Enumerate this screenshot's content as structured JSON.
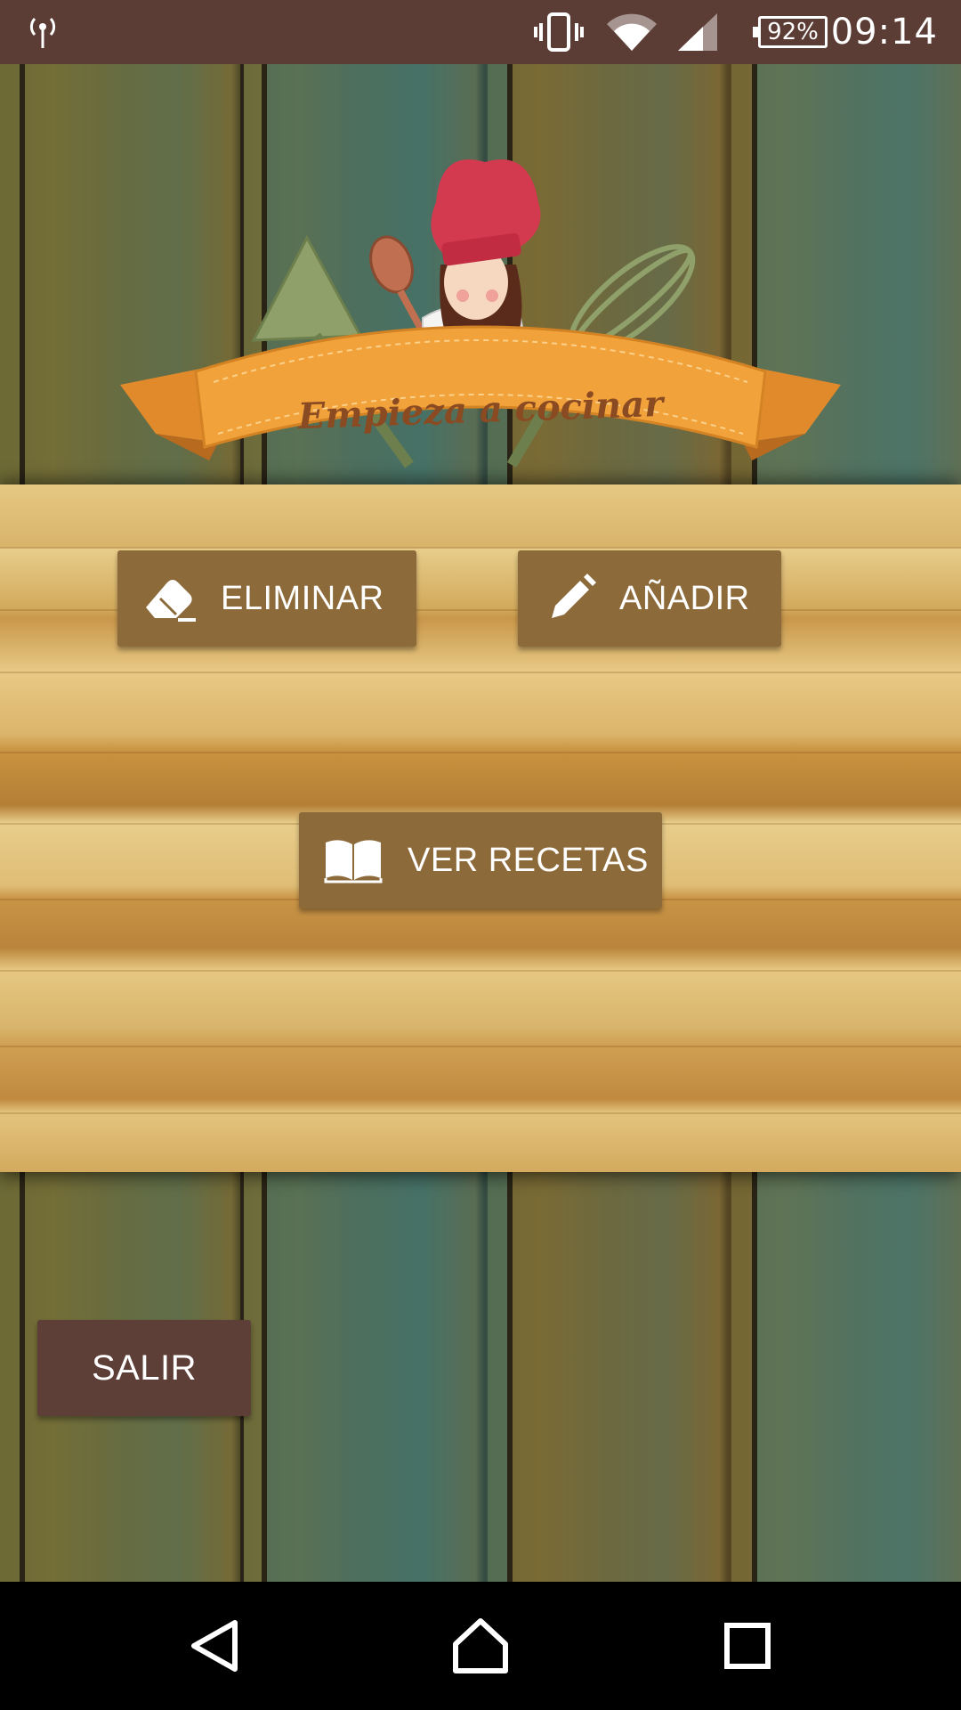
{
  "status_bar": {
    "battery": "92%",
    "time": "09:14",
    "icons": [
      "antenna-icon",
      "vibrate-icon",
      "wifi-icon",
      "cell-signal-icon",
      "battery-icon"
    ]
  },
  "logo": {
    "title": "Empieza a cocinar"
  },
  "buttons": {
    "eliminar": "ELIMINAR",
    "anadir": "AÑADIR",
    "ver_recetas": "VER RECETAS",
    "salir": "SALIR"
  },
  "colors": {
    "status_bar": "#5b3d35",
    "action_button": "#8d6a3a",
    "exit_button": "#5d3f37",
    "nav_bar": "#000000"
  },
  "nav_bar": {
    "icons": [
      "back-icon",
      "home-icon",
      "recents-icon"
    ]
  }
}
